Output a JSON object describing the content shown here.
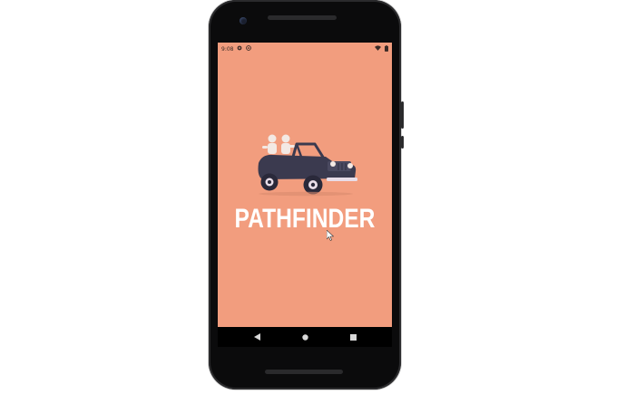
{
  "status_bar": {
    "time": "9:08",
    "left_icons": [
      "settings-icon",
      "notification-icon"
    ],
    "right_icons": [
      "wifi-icon",
      "battery-icon"
    ]
  },
  "app": {
    "title": "PATHFINDER",
    "background_color": "#f29d7e",
    "logo": "jeep-with-passengers-illustration"
  },
  "nav_bar": {
    "buttons": [
      "back-icon",
      "home-icon",
      "recents-icon"
    ]
  }
}
